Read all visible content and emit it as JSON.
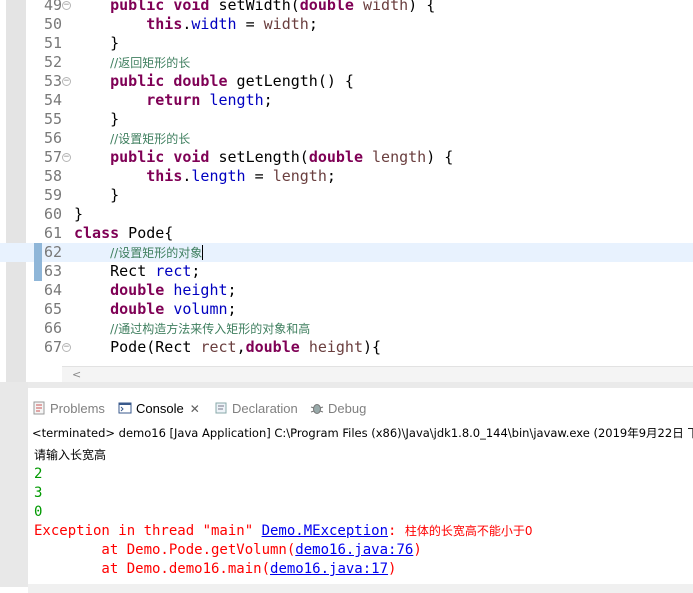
{
  "editor": {
    "lines": [
      {
        "num": "49",
        "fold": true,
        "indent": "    ",
        "parts": [
          {
            "t": "public",
            "c": "kw"
          },
          {
            "t": " "
          },
          {
            "t": "void",
            "c": "kw"
          },
          {
            "t": " setWidth("
          },
          {
            "t": "double",
            "c": "kw"
          },
          {
            "t": " "
          },
          {
            "t": "width",
            "c": "prm"
          },
          {
            "t": ") {"
          }
        ]
      },
      {
        "num": "50",
        "indent": "        ",
        "parts": [
          {
            "t": "this",
            "c": "kw"
          },
          {
            "t": "."
          },
          {
            "t": "width",
            "c": "fld"
          },
          {
            "t": " = "
          },
          {
            "t": "width",
            "c": "prm"
          },
          {
            "t": ";"
          }
        ]
      },
      {
        "num": "51",
        "indent": "    ",
        "parts": [
          {
            "t": "}"
          }
        ]
      },
      {
        "num": "52",
        "indent": "    ",
        "parts": [
          {
            "t": "//返回矩形的长",
            "c": "cmt"
          }
        ]
      },
      {
        "num": "53",
        "fold": true,
        "indent": "    ",
        "parts": [
          {
            "t": "public",
            "c": "kw"
          },
          {
            "t": " "
          },
          {
            "t": "double",
            "c": "kw"
          },
          {
            "t": " getLength() {"
          }
        ]
      },
      {
        "num": "54",
        "indent": "        ",
        "parts": [
          {
            "t": "return",
            "c": "kw"
          },
          {
            "t": " "
          },
          {
            "t": "length",
            "c": "fld"
          },
          {
            "t": ";"
          }
        ]
      },
      {
        "num": "55",
        "indent": "    ",
        "parts": [
          {
            "t": "}"
          }
        ]
      },
      {
        "num": "56",
        "indent": "    ",
        "parts": [
          {
            "t": "//设置矩形的长",
            "c": "cmt"
          }
        ]
      },
      {
        "num": "57",
        "fold": true,
        "indent": "    ",
        "parts": [
          {
            "t": "public",
            "c": "kw"
          },
          {
            "t": " "
          },
          {
            "t": "void",
            "c": "kw"
          },
          {
            "t": " setLength("
          },
          {
            "t": "double",
            "c": "kw"
          },
          {
            "t": " "
          },
          {
            "t": "length",
            "c": "prm"
          },
          {
            "t": ") {"
          }
        ]
      },
      {
        "num": "58",
        "indent": "        ",
        "parts": [
          {
            "t": "this",
            "c": "kw"
          },
          {
            "t": "."
          },
          {
            "t": "length",
            "c": "fld"
          },
          {
            "t": " = "
          },
          {
            "t": "length",
            "c": "prm"
          },
          {
            "t": ";"
          }
        ]
      },
      {
        "num": "59",
        "indent": "    ",
        "parts": [
          {
            "t": "}"
          }
        ]
      },
      {
        "num": "60",
        "indent": "",
        "parts": [
          {
            "t": "}"
          }
        ]
      },
      {
        "num": "61",
        "indent": "",
        "parts": [
          {
            "t": "class",
            "c": "kw"
          },
          {
            "t": " Pode{"
          }
        ]
      },
      {
        "num": "62",
        "current": true,
        "mark": true,
        "indent": "    ",
        "parts": [
          {
            "t": "//设置矩形的对象",
            "c": "cmt"
          }
        ]
      },
      {
        "num": "63",
        "mark": true,
        "indent": "    ",
        "parts": [
          {
            "t": "Rect "
          },
          {
            "t": "rect",
            "c": "fld"
          },
          {
            "t": ";"
          }
        ]
      },
      {
        "num": "64",
        "indent": "    ",
        "parts": [
          {
            "t": "double",
            "c": "kw"
          },
          {
            "t": " "
          },
          {
            "t": "height",
            "c": "fld"
          },
          {
            "t": ";"
          }
        ]
      },
      {
        "num": "65",
        "indent": "    ",
        "parts": [
          {
            "t": "double",
            "c": "kw"
          },
          {
            "t": " "
          },
          {
            "t": "volumn",
            "c": "fld"
          },
          {
            "t": ";"
          }
        ]
      },
      {
        "num": "66",
        "indent": "    ",
        "parts": [
          {
            "t": "//通过构造方法来传入矩形的对象和高",
            "c": "cmt"
          }
        ]
      },
      {
        "num": "67",
        "fold": true,
        "indent": "    ",
        "parts": [
          {
            "t": "Pode(Rect "
          },
          {
            "t": "rect",
            "c": "prm"
          },
          {
            "t": ","
          },
          {
            "t": "double",
            "c": "kw"
          },
          {
            "t": " "
          },
          {
            "t": "height",
            "c": "prm"
          },
          {
            "t": "){"
          }
        ]
      }
    ]
  },
  "tabs": [
    {
      "label": "Problems",
      "icon": "problems-icon",
      "active": false
    },
    {
      "label": "Console",
      "icon": "console-icon",
      "active": true,
      "close": "✕"
    },
    {
      "label": "Declaration",
      "icon": "declaration-icon",
      "active": false
    },
    {
      "label": "Debug",
      "icon": "debug-icon",
      "active": false
    }
  ],
  "console": {
    "title": "<terminated> demo16 [Java Application] C:\\Program Files (x86)\\Java\\jdk1.8.0_144\\bin\\javaw.exe (2019年9月22日 下",
    "prompt": "请输入长宽高",
    "inputs": [
      "2",
      "3",
      "0"
    ],
    "exception": {
      "prefix": "Exception in thread \"main\" ",
      "class_link": "Demo.MException",
      "sep": ": ",
      "message": "柱体的长宽高不能小于0"
    },
    "stack": [
      {
        "prefix": "        at Demo.Pode.getVolumn(",
        "link": "demo16.java:76",
        "suffix": ")"
      },
      {
        "prefix": "        at Demo.demo16.main(",
        "link": "demo16.java:17",
        "suffix": ")"
      }
    ]
  },
  "colors": {
    "keyword": "#7f0055",
    "field": "#0000c0",
    "comment": "#3f7f5f",
    "stdin": "#009900",
    "stderr": "#ff0000",
    "link": "#0000ee"
  }
}
